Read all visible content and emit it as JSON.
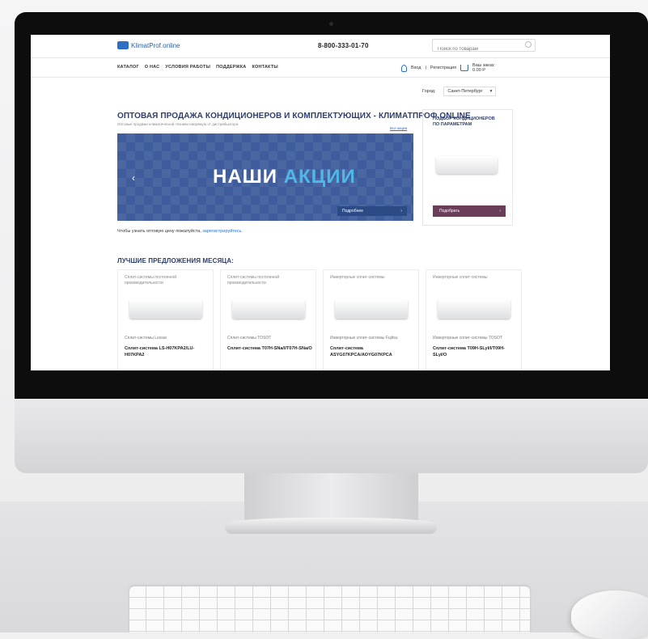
{
  "site": {
    "logo_text": "KlimatProf.online",
    "phone": "8-800-333-01-70",
    "search_placeholder": "Поиск по товарам"
  },
  "nav": {
    "items": [
      "КАТАЛОГ",
      "О НАС",
      "УСЛОВИЯ РАБОТЫ",
      "ПОДДЕРЖКА",
      "КОНТАКТЫ"
    ]
  },
  "account": {
    "login": "Вход",
    "separator": "|",
    "register": "Регистрация",
    "cart_label": "Ваш заказ:",
    "cart_total": "0.00 Р"
  },
  "city": {
    "label": "Город:",
    "value": "Санкт-Петербург"
  },
  "main": {
    "headline": "ОПТОВАЯ ПРОДАЖА КОНДИЦИОНЕРОВ И КОМПЛЕКТУЮЩИХ - КЛИМАТПРОФ.ONLINE",
    "subheadline": "Оптовые продажи климатической техники напрямую от дистрибьютора",
    "all_promos": "Все акции",
    "banner_title_1": "НАШИ",
    "banner_title_2": "АКЦИИ",
    "banner_button": "Подробнее",
    "register_text": "Чтобы узнать оптовую цену пожалуйста,",
    "register_link": "зарегистрируйтесь.",
    "best_title": "ЛУЧШИЕ ПРЕДЛОЖЕНИЯ МЕСЯЦА:"
  },
  "sidebar": {
    "title": "ПОДБОР КОНДИЦИОНЕРОВ ПО ПАРАМЕТРАМ",
    "button": "Подобрать"
  },
  "products": [
    {
      "category": "Сплит-системы постоянной производительности",
      "brand": "Сплит-системы Lessar",
      "model": "Сплит-система LS-H07KPA2/LU-H07KPA2"
    },
    {
      "category": "Сплит-системы постоянной производительности",
      "brand": "Сплит-системы TOSOT",
      "model": "Сплит-система T07H-SNa/I/T07H-SNa/O"
    },
    {
      "category": "Инверторные сплит-системы",
      "brand": "Инверторные сплит-системы Fujitsu",
      "model": "Сплит-система ASYG07KPCA/AOYG07KPCA"
    },
    {
      "category": "Инверторные сплит-системы",
      "brand": "Инверторные сплит-системы TOSOT",
      "model": "Сплит-система T09H-SLyI/I/T09H-SLyI/O"
    }
  ],
  "colors": {
    "brand_blue": "#2d70c8",
    "headline_navy": "#2e3e6e",
    "banner_bg": "#3f5d9c",
    "banner_accent": "#4fb8e6",
    "sidebar_button": "#6a3d58"
  }
}
